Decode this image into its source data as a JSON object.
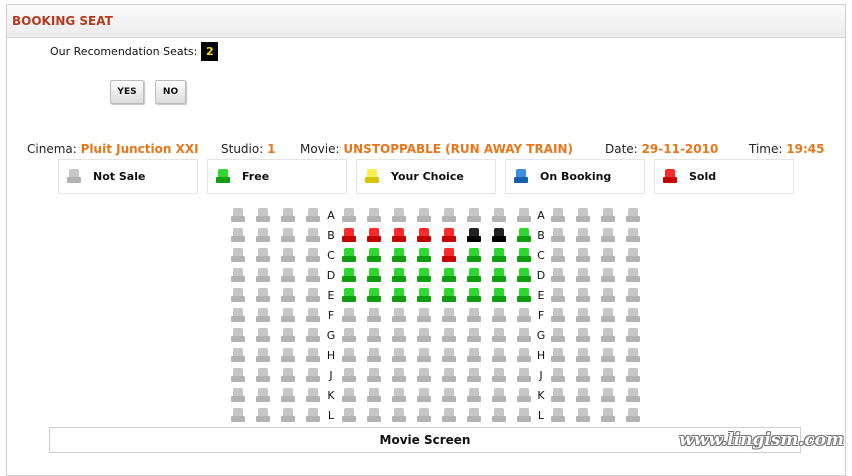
{
  "header": {
    "title": "BOOKING SEAT"
  },
  "recommendation": {
    "label": "Our Recomendation Seats:",
    "count": "2"
  },
  "buttons": {
    "yes": "YES",
    "no": "NO"
  },
  "info": {
    "cinema_label": "Cinema:",
    "cinema": "Pluit Junction XXI",
    "studio_label": "Studio:",
    "studio": "1",
    "movie_label": "Movie:",
    "movie": "UNSTOPPABLE (RUN AWAY TRAIN)",
    "date_label": "Date:",
    "date": "29-11-2010",
    "time_label": "Time:",
    "time": "19:45"
  },
  "legend": [
    {
      "label": "Not Sale",
      "status": "grey"
    },
    {
      "label": "Free",
      "status": "green"
    },
    {
      "label": "Your Choice",
      "status": "yellow"
    },
    {
      "label": "On Booking",
      "status": "blue"
    },
    {
      "label": "Sold",
      "status": "red"
    }
  ],
  "colors": {
    "accent": "#e8761b",
    "header_text": "#b33a1e",
    "grey": "#b3b3b3",
    "green": "#0e9e0e",
    "red": "#c60000",
    "black": "#000000",
    "yellow": "#ffec4d",
    "blue": "#1560ae"
  },
  "seatmap": {
    "rows": [
      "A",
      "B",
      "C",
      "D",
      "E",
      "F",
      "G",
      "H",
      "J",
      "K",
      "L"
    ],
    "left_block": 4,
    "middle_block": 8,
    "right_block": 4,
    "middle_status": {
      "A": [
        "grey",
        "grey",
        "grey",
        "grey",
        "grey",
        "grey",
        "grey",
        "grey"
      ],
      "B": [
        "red",
        "red",
        "red",
        "red",
        "red",
        "black",
        "black",
        "green"
      ],
      "C": [
        "green",
        "green",
        "green",
        "green",
        "red",
        "green",
        "green",
        "green"
      ],
      "D": [
        "green",
        "green",
        "green",
        "green",
        "green",
        "green",
        "green",
        "green"
      ],
      "E": [
        "green",
        "green",
        "green",
        "green",
        "green",
        "green",
        "green",
        "green"
      ],
      "F": [
        "grey",
        "grey",
        "grey",
        "grey",
        "grey",
        "grey",
        "grey",
        "grey"
      ],
      "G": [
        "grey",
        "grey",
        "grey",
        "grey",
        "grey",
        "grey",
        "grey",
        "grey"
      ],
      "H": [
        "grey",
        "grey",
        "grey",
        "grey",
        "grey",
        "grey",
        "grey",
        "grey"
      ],
      "J": [
        "grey",
        "grey",
        "grey",
        "grey",
        "grey",
        "grey",
        "grey",
        "grey"
      ],
      "K": [
        "grey",
        "grey",
        "grey",
        "grey",
        "grey",
        "grey",
        "grey",
        "grey"
      ],
      "L": [
        "grey",
        "grey",
        "grey",
        "grey",
        "grey",
        "grey",
        "grey",
        "grey"
      ]
    }
  },
  "screen_label": "Movie Screen",
  "watermark": "www.lingism.com"
}
